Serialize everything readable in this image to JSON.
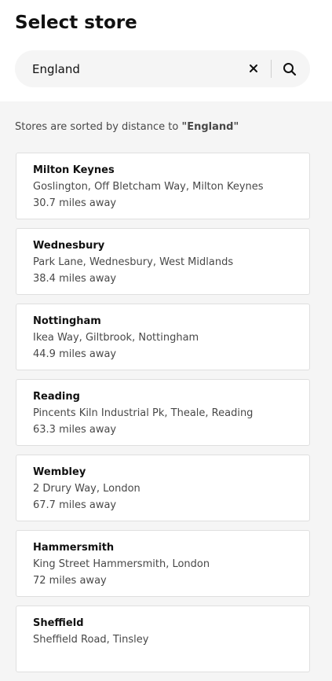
{
  "header": {
    "title": "Select store"
  },
  "search": {
    "value": "England",
    "clear_icon": "close-icon",
    "search_icon": "search-icon"
  },
  "sort_note": {
    "prefix": "Stores are sorted by distance to ",
    "query": "\"England\""
  },
  "stores": [
    {
      "name": "Milton Keynes",
      "address": "Goslington, Off Bletcham Way, Milton Keynes",
      "distance": "30.7 miles away"
    },
    {
      "name": "Wednesbury",
      "address": "Park Lane, Wednesbury, West Midlands",
      "distance": "38.4 miles away"
    },
    {
      "name": "Nottingham",
      "address": "Ikea Way, Giltbrook, Nottingham",
      "distance": "44.9 miles away"
    },
    {
      "name": "Reading",
      "address": "Pincents Kiln Industrial Pk, Theale, Reading",
      "distance": "63.3 miles away"
    },
    {
      "name": "Wembley",
      "address": "2 Drury Way, London",
      "distance": "67.7 miles away"
    },
    {
      "name": "Hammersmith",
      "address": "King Street Hammersmith, London",
      "distance": "72 miles away"
    },
    {
      "name": "Sheffield",
      "address": "Sheffield Road, Tinsley",
      "distance": ""
    }
  ]
}
